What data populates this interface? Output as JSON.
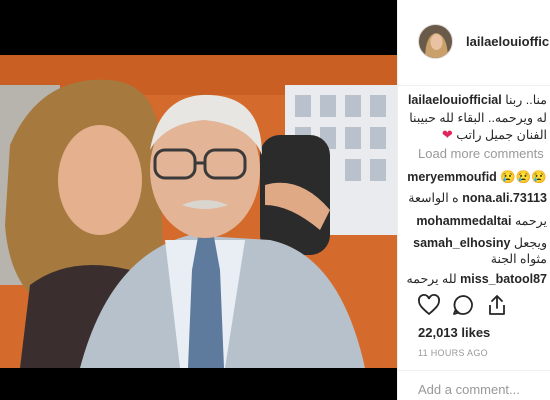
{
  "post": {
    "username": "lailaelouiofficial",
    "caption_user": "lailaelouiofficial",
    "caption_line1": "منا.. ربنا",
    "caption_line2": "له ويرحمه.. البقاء لله حبيبنا",
    "caption_line3": "الفنان جميل راتب",
    "heart_icon": "red-heart",
    "load_more": "Load more comments",
    "likes": "22,013 likes",
    "time": "11 HOURS AGO",
    "add_comment": "Add a comment..."
  },
  "comments": [
    {
      "user": "meryemmoufid",
      "text": "😢😢😢"
    },
    {
      "user": "nona.ali.73113",
      "text": "ه الواسعة"
    },
    {
      "user": "mohammedaltai",
      "text": "يرحمه"
    },
    {
      "user": "samah_elhosiny",
      "text": "ويجعل",
      "text2": "مثواه الجنة"
    },
    {
      "user": "miss_batool87",
      "text": "لله يرحمه"
    }
  ],
  "icons": {
    "like": "heart-outline-icon",
    "comment": "speech-bubble-icon",
    "share": "share-upload-icon"
  },
  "colors": {
    "heart": "#e0245e",
    "muted": "#999999",
    "photo_background": "#d06a2a"
  }
}
